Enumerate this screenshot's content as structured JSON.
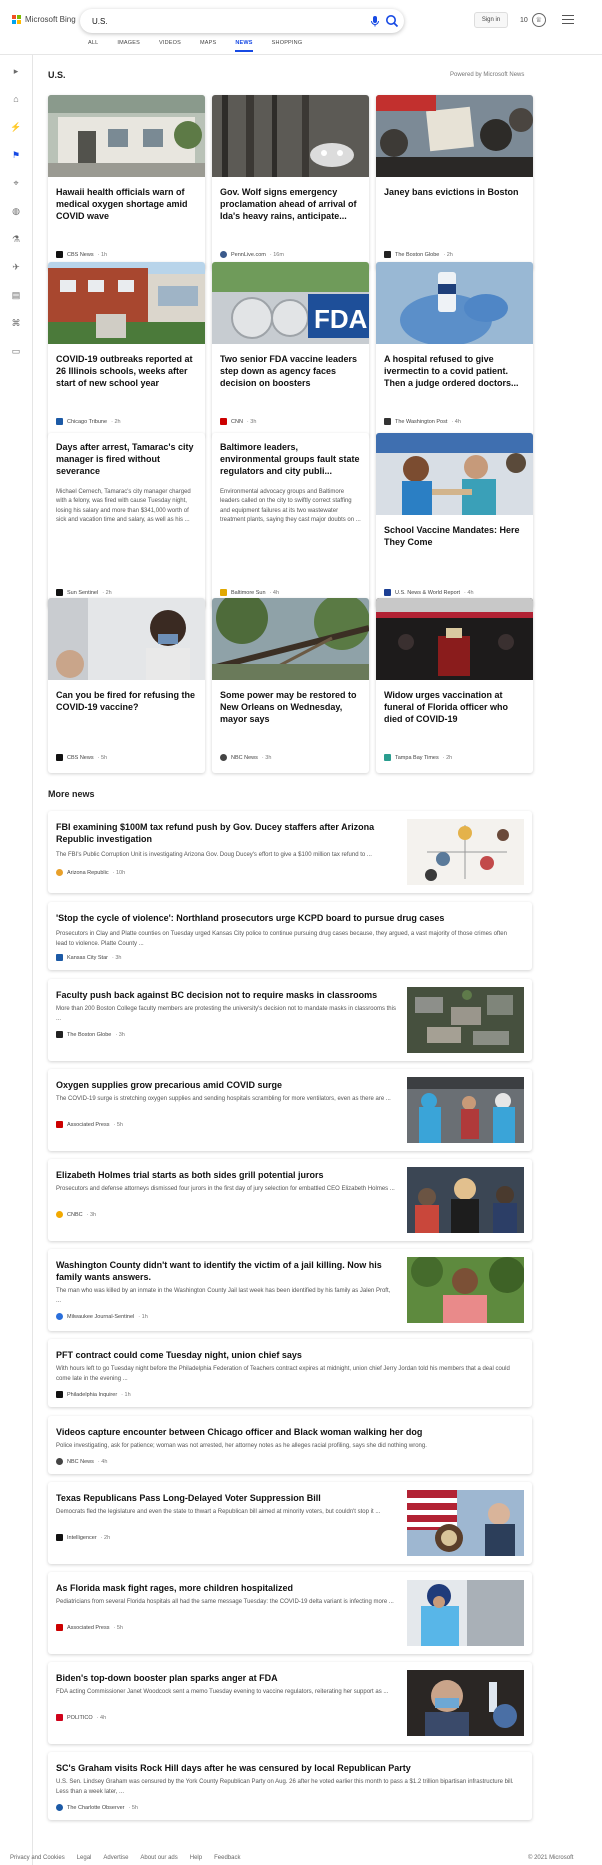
{
  "header": {
    "logo_text": "Microsoft Bing",
    "search_value": "U.S.",
    "sign_in": "Sign in",
    "rewards_count": "10"
  },
  "tabs": [
    "ALL",
    "IMAGES",
    "VIDEOS",
    "MAPS",
    "NEWS",
    "SHOPPING"
  ],
  "active_tab": "NEWS",
  "section": {
    "title": "U.S.",
    "powered": "Powered by Microsoft News"
  },
  "cards": [
    {
      "title": "Hawaii health officials warn of medical oxygen shortage amid COVID wave",
      "source": "CBS News",
      "time": "1h",
      "icon_color": "#111111"
    },
    {
      "title": "Gov. Wolf signs emergency proclamation ahead of arrival of Ida's heavy rains, anticipate...",
      "source": "PennLive.com",
      "time": "16m",
      "icon_color": "#3a5a8c"
    },
    {
      "title": "Janey bans evictions in Boston",
      "source": "The Boston Globe",
      "time": "2h",
      "icon_color": "#222222"
    },
    {
      "title": "COVID-19 outbreaks reported at 26 Illinois schools, weeks after start of new school year",
      "source": "Chicago Tribune",
      "time": "2h",
      "icon_color": "#1c5aa6"
    },
    {
      "title": "Two senior FDA vaccine leaders step down as agency faces decision on boosters",
      "source": "CNN",
      "time": "3h",
      "icon_color": "#cc0000"
    },
    {
      "title": "A hospital refused to give ivermectin to a covid patient. Then a judge ordered doctors...",
      "source": "The Washington Post",
      "time": "4h",
      "icon_color": "#333333"
    },
    {
      "title": "Days after arrest, Tamarac's city manager is fired without severance",
      "snippet": "Michael Cernech, Tamarac's city manager charged with a felony, was fired with cause Tuesday night, losing his salary and more than $341,000 worth of sick and vacation time and salary, as well as his ...",
      "source": "Sun Sentinel",
      "time": "2h",
      "icon_color": "#111111"
    },
    {
      "title": "Baltimore leaders, environmental groups fault state regulators and city publi...",
      "snippet": "Environmental advocacy groups and Baltimore leaders called on the city to swiftly correct staffing and equipment failures at its two wastewater treatment plants, saying they cast major doubts on ...",
      "source": "Baltimore Sun",
      "time": "4h",
      "icon_color": "#e0a800"
    },
    {
      "title": "School Vaccine Mandates: Here They Come",
      "source": "U.S. News & World Report",
      "time": "4h",
      "icon_color": "#1c3f94"
    },
    {
      "title": "Can you be fired for refusing the COVID-19 vaccine?",
      "source": "CBS News",
      "time": "5h",
      "icon_color": "#111111"
    },
    {
      "title": "Some power may be restored to New Orleans on Wednesday, mayor says",
      "source": "NBC News",
      "time": "3h",
      "icon_color": "#444444"
    },
    {
      "title": "Widow urges vaccination at funeral of Florida officer who died of COVID-19",
      "source": "Tampa Bay Times",
      "time": "2h",
      "icon_color": "#2a9d8f"
    }
  ],
  "more_news": {
    "title": "More news",
    "items": [
      {
        "title": "FBI examining $100M tax refund push by Gov. Ducey staffers after Arizona Republic investigation",
        "snippet": "The FBI's Public Corruption Unit is investigating Arizona Gov. Doug Ducey's effort to give a $100 million tax refund to ...",
        "source": "Arizona Republic",
        "time": "10h",
        "icon_color": "#e8a02a"
      },
      {
        "title": "'Stop the cycle of violence': Northland prosecutors urge KCPD board to pursue drug cases",
        "snippet": "Prosecutors in Clay and Platte counties on Tuesday urged Kansas City police to continue pursuing drug cases because, they argued, a vast majority of those crimes often lead to violence. Platte County ...",
        "source": "Kansas City Star",
        "time": "3h",
        "icon_color": "#1c5aa6"
      },
      {
        "title": "Faculty push back against BC decision not to require masks in classrooms",
        "snippet": "More than 200 Boston College faculty members are protesting the university's decision not to mandate masks in classrooms this ...",
        "source": "The Boston Globe",
        "time": "3h",
        "icon_color": "#222222"
      },
      {
        "title": "Oxygen supplies grow precarious amid COVID surge",
        "snippet": "The COVID-19 surge is stretching oxygen supplies and sending hospitals scrambling for more ventilators, even as there are ...",
        "source": "Associated Press",
        "time": "5h",
        "icon_color": "#cc0000"
      },
      {
        "title": "Elizabeth Holmes trial starts as both sides grill potential jurors",
        "snippet": "Prosecutors and defense attorneys dismissed four jurors in the first day of jury selection for embattled CEO Elizabeth Holmes ...",
        "source": "CNBC",
        "time": "3h",
        "icon_color": "#f2a900"
      },
      {
        "title": "Washington County didn't want to identify the victim of a jail killing. Now his family wants answers.",
        "snippet": "The man who was killed by an inmate in the Washington County Jail last week has been identified by his family as Jalen Proft, ...",
        "source": "Milwaukee Journal-Sentinel",
        "time": "1h",
        "icon_color": "#2a6fdb"
      },
      {
        "title": "PFT contract could come Tuesday night, union chief says",
        "snippet": "With hours left to go Tuesday night before the Philadelphia Federation of Teachers contract expires at midnight, union chief Jerry Jordan told his members that a deal could come late in the evening ...",
        "source": "Philadelphia Inquirer",
        "time": "1h",
        "icon_color": "#111111"
      },
      {
        "title": "Videos capture encounter between Chicago officer and Black woman walking her dog",
        "snippet": "Police investigating, ask for patience; woman was not arrested, her attorney notes as he alleges racial profiling, says she did nothing wrong.",
        "source": "NBC News",
        "time": "4h",
        "icon_color": "#444444"
      },
      {
        "title": "Texas Republicans Pass Long-Delayed Voter Suppression Bill",
        "snippet": "Democrats fled the legislature and even the state to thwart a Republican bill aimed at minority voters, but couldn't stop it ...",
        "source": "Intelligencer",
        "time": "2h",
        "icon_color": "#111111"
      },
      {
        "title": "As Florida mask fight rages, more children hospitalized",
        "snippet": "Pediatricians from several Florida hospitals all had the same message Tuesday: the COVID-19 delta variant is infecting more ...",
        "source": "Associated Press",
        "time": "5h",
        "icon_color": "#cc0000"
      },
      {
        "title": "Biden's top-down booster plan sparks anger at FDA",
        "snippet": "FDA acting Commissioner Janet Woodcock sent a memo Tuesday evening to vaccine regulators, reiterating her support as ...",
        "source": "POLITICO",
        "time": "4h",
        "icon_color": "#d0021b"
      },
      {
        "title": "SC's Graham visits Rock Hill days after he was censured by local Republican Party",
        "snippet": "U.S. Sen. Lindsey Graham was censured by the York County Republican Party on Aug. 26 after he voted earlier this month to pass a $1.2 trillion bipartisan infrastructure bill. Less than a week later, ...",
        "source": "The Charlotte Observer",
        "time": "5h",
        "icon_color": "#1c5aa6"
      }
    ]
  },
  "footer": {
    "links": [
      "Privacy and Cookies",
      "Legal",
      "Advertise",
      "About our ads",
      "Help",
      "Feedback"
    ],
    "copyright": "© 2021 Microsoft"
  },
  "colors": {
    "accent": "#174ae4",
    "text": "#111111",
    "muted": "#555555"
  }
}
